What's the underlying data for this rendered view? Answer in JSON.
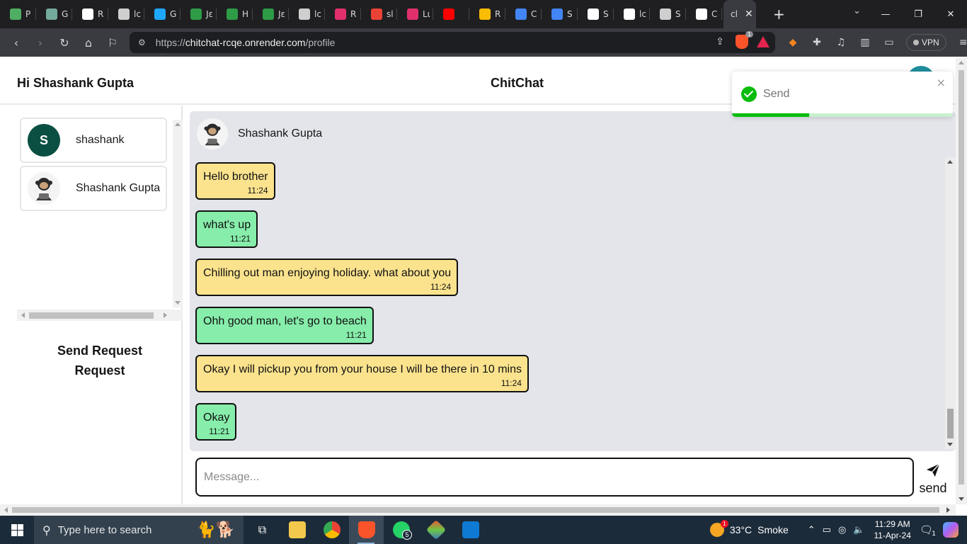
{
  "browser": {
    "tabs": [
      {
        "label": "P",
        "icon": "pinwheel-icon",
        "color": "#4fae63"
      },
      {
        "label": "G",
        "icon": "chatgpt-icon",
        "color": "#74aa9c"
      },
      {
        "label": "R",
        "icon": "notion-icon",
        "color": "#ffffff"
      },
      {
        "label": "lc",
        "icon": "globe-icon",
        "color": "#cfcfcf"
      },
      {
        "label": "G",
        "icon": "wave-icon",
        "color": "#1ea7fd"
      },
      {
        "label": "Jε",
        "icon": "w-logo-icon",
        "color": "#2e9b46"
      },
      {
        "label": "H",
        "icon": "link-icon",
        "color": "#2e9b46"
      },
      {
        "label": "Jε",
        "icon": "w-logo-icon",
        "color": "#2e9b46"
      },
      {
        "label": "lc",
        "icon": "globe-icon",
        "color": "#cfcfcf"
      },
      {
        "label": "R",
        "icon": "instagram-icon",
        "color": "#e1306c"
      },
      {
        "label": "sl",
        "icon": "gmail-icon",
        "color": "#ea4335"
      },
      {
        "label": "Lι",
        "icon": "instagram-icon",
        "color": "#e1306c"
      },
      {
        "label": "",
        "icon": "youtube-icon",
        "color": "#ff0000"
      },
      {
        "label": "R",
        "icon": "drive-icon",
        "color": "#fbbc04"
      },
      {
        "label": "C",
        "icon": "docs-icon",
        "color": "#4285f4"
      },
      {
        "label": "S",
        "icon": "docs-icon",
        "color": "#4285f4"
      },
      {
        "label": "S",
        "icon": "github-icon",
        "color": "#ffffff"
      },
      {
        "label": "lc",
        "icon": "render-icon",
        "color": "#ffffff"
      },
      {
        "label": "S",
        "icon": "settings-icon",
        "color": "#cfcfcf"
      },
      {
        "label": "C",
        "icon": "render-icon",
        "color": "#ffffff"
      }
    ],
    "active_tab": {
      "label": "cl",
      "close": "✕"
    },
    "new_tab": "+",
    "url": {
      "scheme": "https://",
      "host": "chitchat-rcqe.onrender.com",
      "path": "/profile"
    },
    "shields_count": "1",
    "vpn_label": "VPN"
  },
  "app": {
    "greeting": "Hi Shashank Gupta",
    "title": "ChitChat",
    "contacts": [
      {
        "name": "shashank",
        "initial": "S",
        "avatar": "letter"
      },
      {
        "name": "Shashank Gupta",
        "initial": "",
        "avatar": "monkey"
      }
    ],
    "send_request_lines": [
      "Send Request",
      "Request"
    ],
    "chat": {
      "partner_name": "Shashank Gupta",
      "messages": [
        {
          "text": "Hello brother",
          "time": "11:24",
          "color": "yellow"
        },
        {
          "text": "what's up",
          "time": "11:21",
          "color": "green"
        },
        {
          "text": "Chilling out man enjoying holiday. what about you",
          "time": "11:24",
          "color": "yellow"
        },
        {
          "text": "Ohh good man, let's go to beach",
          "time": "11:21",
          "color": "green"
        },
        {
          "text": "Okay I will pickup you from your house I will be there in 10 mins",
          "time": "11:24",
          "color": "yellow"
        },
        {
          "text": "Okay",
          "time": "11:21",
          "color": "green"
        }
      ]
    },
    "input": {
      "placeholder": "Message...",
      "value": ""
    },
    "send_label": "send",
    "toast": {
      "message": "Send",
      "close": "×",
      "progress": 0.35
    }
  },
  "taskbar": {
    "search_placeholder": "Type here to search",
    "apps": [
      {
        "icon": "task-view-icon"
      },
      {
        "icon": "file-explorer-icon"
      },
      {
        "icon": "chrome-icon"
      },
      {
        "icon": "brave-icon",
        "active": true
      },
      {
        "icon": "whatsapp-icon",
        "badge": "5"
      },
      {
        "icon": "git-icon"
      },
      {
        "icon": "vscode-icon"
      }
    ],
    "weather": {
      "temp": "33°C",
      "condition": "Smoke",
      "alert": "1"
    },
    "clock": {
      "time": "11:29 AM",
      "date": "11-Apr-24"
    },
    "notifications": "1"
  },
  "colors": {
    "message_yellow": "#fbe38e",
    "message_green": "#86edaa",
    "chat_bg": "#e4e5ea",
    "toast_success": "#07bc0c",
    "contact_avatar": "#0b4f42"
  }
}
